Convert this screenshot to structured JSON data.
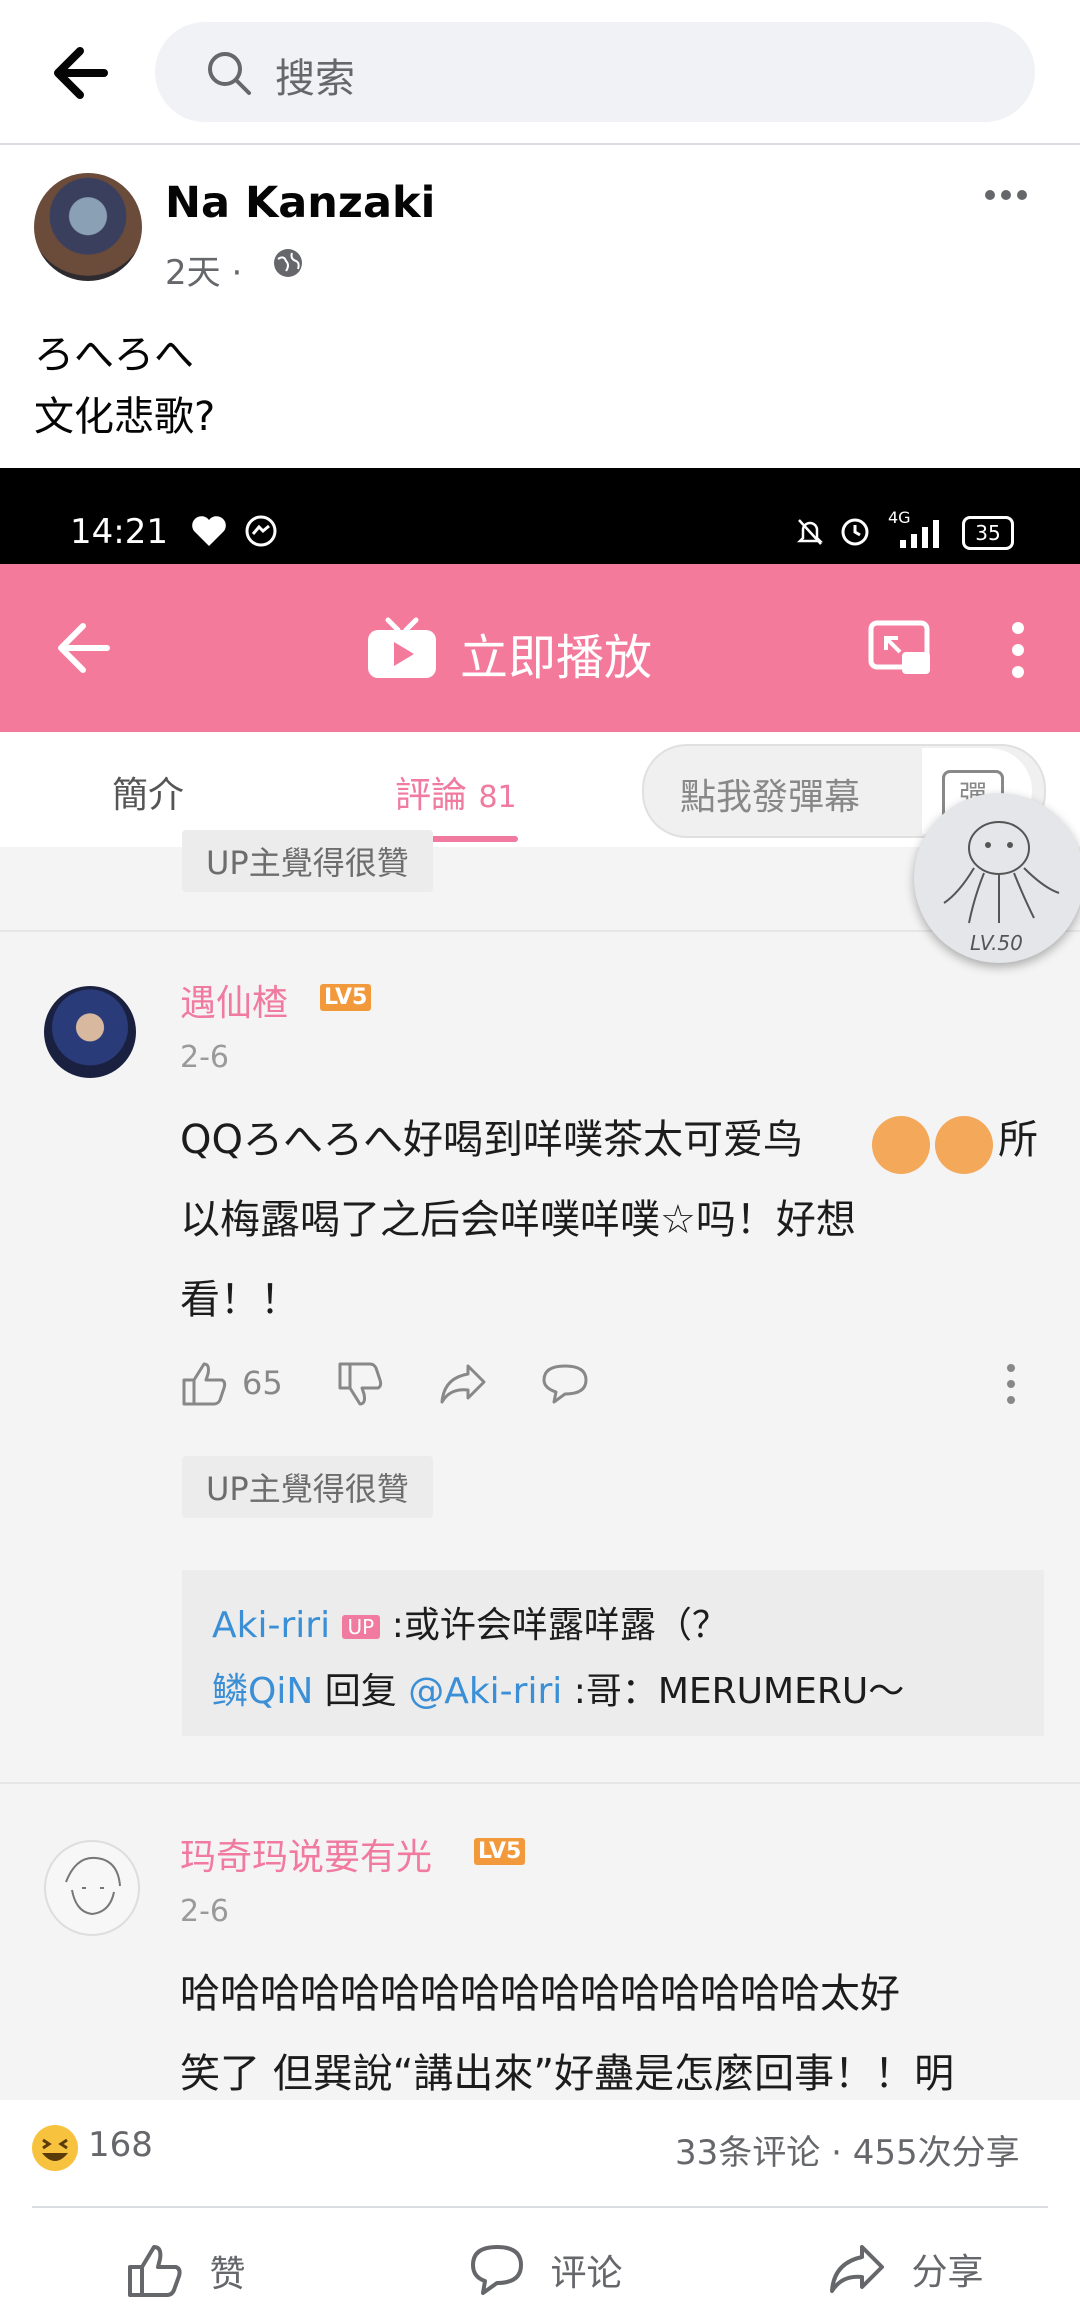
{
  "search": {
    "placeholder": "搜索"
  },
  "post": {
    "author": "Na Kanzaki",
    "time": "2天",
    "separator": "·",
    "lines": [
      "ろへろへ",
      "文化悲歌?"
    ]
  },
  "shot": {
    "status": {
      "time": "14:21",
      "battery": "35",
      "network": "4G"
    },
    "header": {
      "title": "立即播放"
    },
    "tabs": {
      "intro": "簡介",
      "comments": "評論",
      "comments_count": "81",
      "danmaku_placeholder": "點我發彈幕",
      "danmaku_btn": "彈"
    },
    "up_tag": "UP主覺得很贊",
    "stamp_text": "LV.50",
    "comments": [
      {
        "user": "遇仙楂",
        "level": "LV5",
        "date": "2-6",
        "lines": [
          "QQろへろへ好喝到咩噗茶太可爱鸟",
          "所",
          "以梅露喝了之后会咩噗咩噗☆吗！好想",
          "看！！"
        ],
        "likes": "65",
        "tag": "UP主覺得很贊",
        "replies": [
          {
            "user": "Aki-riri",
            "badge": "UP",
            "text": ":或许会咩露咩露（？"
          },
          {
            "user": "鳞QiN",
            "mid": "回复",
            "mention": "@Aki-riri",
            "text": ":哥：MERUMERU～"
          }
        ]
      },
      {
        "user": "玛奇玛说要有光",
        "level": "LV5",
        "date": "2-6",
        "lines": [
          "哈哈哈哈哈哈哈哈哈哈哈哈哈哈哈哈太好",
          "笑了 但巽說“講出來”好蠱是怎麼回事！！明"
        ]
      }
    ]
  },
  "reactions": {
    "count": "168",
    "comments": "33条评论",
    "separator": "·",
    "shares": "455次分享"
  },
  "actions": {
    "like": "赞",
    "comment": "评论",
    "share": "分享"
  }
}
